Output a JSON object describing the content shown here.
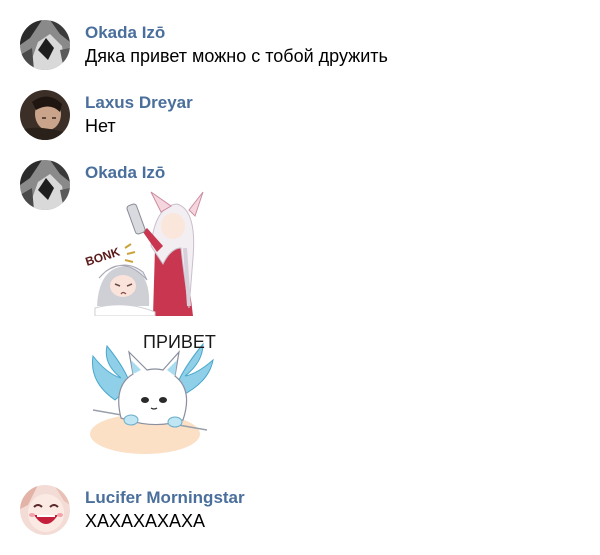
{
  "messages": [
    {
      "author": "Okada Izō",
      "text": "Дяка привет можно с тобой дружить",
      "avatar_icon": "grayscale-portrait-avatar"
    },
    {
      "author": "Laxus Dreyar",
      "text": "Нет",
      "avatar_icon": "dark-portrait-avatar"
    },
    {
      "author": "Okada Izō",
      "avatar_icon": "grayscale-portrait-avatar",
      "stickers": [
        {
          "icon": "bonk-sticker",
          "caption": "BONK"
        },
        {
          "icon": "privet-fox-sticker",
          "caption": "ПРИВЕТ"
        }
      ]
    },
    {
      "author": "Lucifer Morningstar",
      "text": "ХАХАХАХАХА",
      "avatar_icon": "laughing-face-avatar"
    }
  ],
  "colors": {
    "author_name": "#4a6f9c",
    "message_text": "#000000",
    "background": "#ffffff"
  }
}
